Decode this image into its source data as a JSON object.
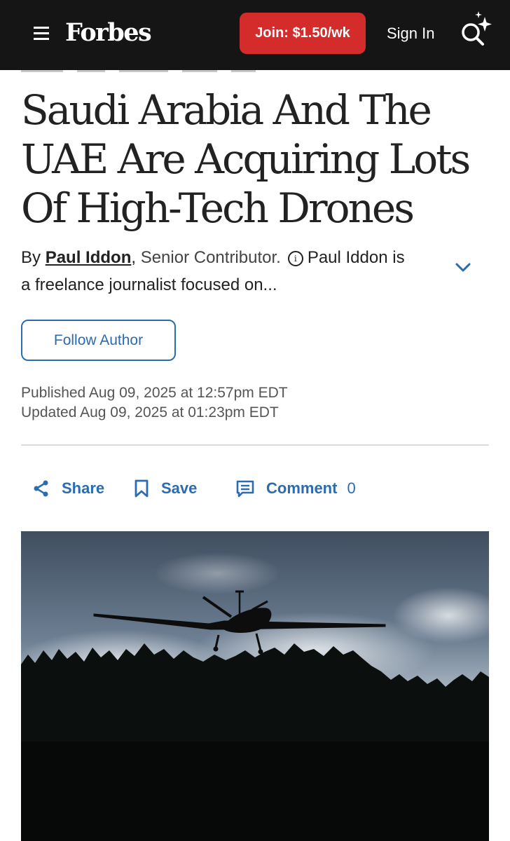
{
  "header": {
    "logo": "Forbes",
    "join_label": "Join: $1.50/wk",
    "signin_label": "Sign In",
    "menu_icon": "hamburger-menu-icon",
    "search_icon": "sparkle-search-icon",
    "background": "#151515",
    "join_color": "#d42b2b"
  },
  "article": {
    "headline": "Saudi Arabia And The UAE Are Acquiring Lots Of High-Tech Drones",
    "byline": {
      "by": "By",
      "author": "Paul Iddon",
      "comma": ",",
      "role": "Senior Contributor.",
      "bio": "Paul Iddon is a freelance journalist focused on..."
    },
    "follow_label": "Follow Author",
    "published": "Published Aug 09, 2025 at 12:57pm EDT",
    "updated": "Updated Aug 09, 2025 at 01:23pm EDT"
  },
  "actions": {
    "share_label": "Share",
    "save_label": "Save",
    "comment_label": "Comment",
    "comment_count": "0",
    "accent": "#2b6cb0"
  },
  "image": {
    "subject": "drone-over-forest-photo"
  }
}
